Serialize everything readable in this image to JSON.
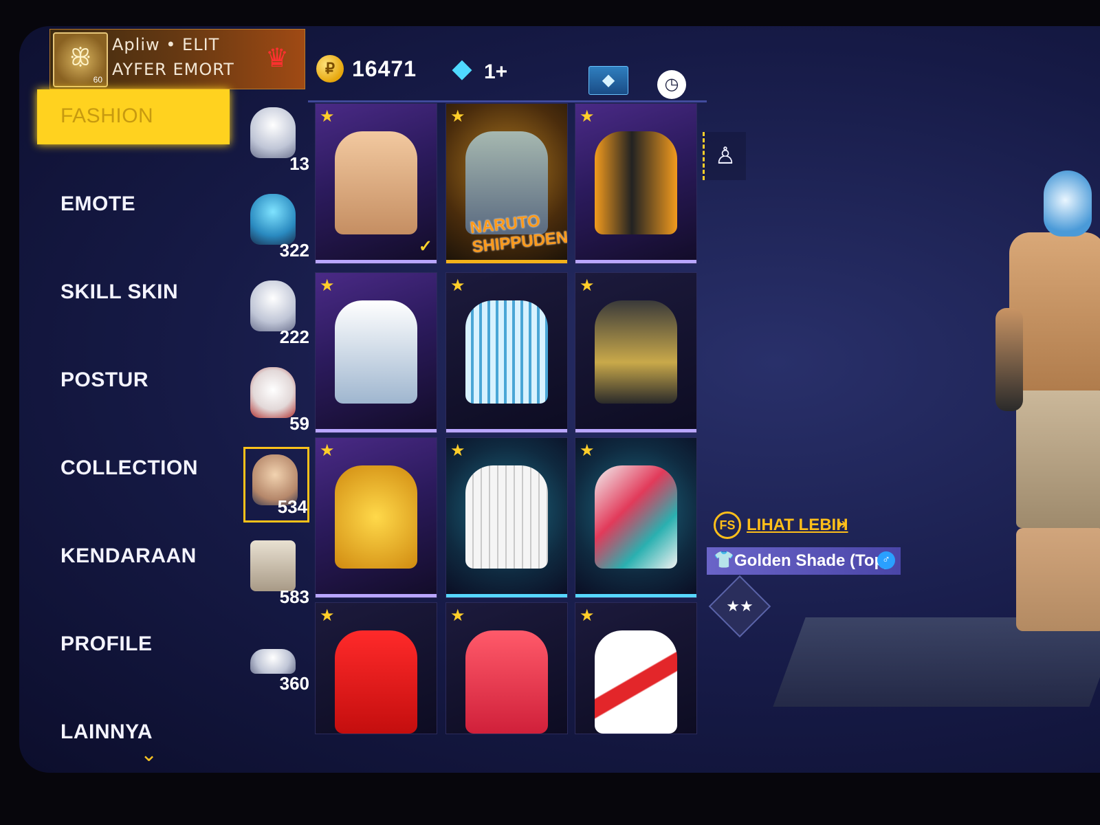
{
  "player": {
    "name": "Apliw • ELIT",
    "guild": "AYFER EMORT",
    "level": "60",
    "avatar_glyph": "ꕥ",
    "rank_icon": "shield-wings-icon"
  },
  "currency": {
    "gold": "16471",
    "diamonds": "1+",
    "gold_symbol": "₽",
    "diamond_symbol": "◆",
    "topup_symbol": "◆",
    "settings_symbol": "◷"
  },
  "categories": [
    {
      "label": "FASHION"
    },
    {
      "label": "EMOTE"
    },
    {
      "label": "SKILL SKIN"
    },
    {
      "label": "POSTUR"
    },
    {
      "label": "COLLECTION"
    },
    {
      "label": "KENDARAAN"
    },
    {
      "label": "PROFILE"
    },
    {
      "label": "LAINNYA"
    }
  ],
  "subcategories": [
    {
      "name": "outfit",
      "count": "13"
    },
    {
      "name": "headwear",
      "count": "322"
    },
    {
      "name": "mask",
      "count": "222"
    },
    {
      "name": "face-paint",
      "count": "59"
    },
    {
      "name": "tops",
      "count": "534"
    },
    {
      "name": "bottoms",
      "count": "583"
    },
    {
      "name": "shoes",
      "count": "360"
    }
  ],
  "items": [
    {
      "name": "Golden Shade (Top)",
      "equipped": true
    },
    {
      "name": "Naruto vest",
      "logo": "NARUTO SHIPPUDEN"
    },
    {
      "name": "orange hoodie"
    },
    {
      "name": "white armored top"
    },
    {
      "name": "striped jacket"
    },
    {
      "name": "hooded black top"
    },
    {
      "name": "gold jersey"
    },
    {
      "name": "white striped shirt"
    },
    {
      "name": "floral shirt"
    },
    {
      "name": "red jersey"
    },
    {
      "name": "pink jersey"
    },
    {
      "name": "white red jersey"
    }
  ],
  "preview": {
    "view_more": "LIHAT LEBIH",
    "view_more_arrows": "»",
    "equipped_name": "Golden Shade (Top)",
    "shirt_symbol": "👕",
    "gender_symbol": "♂",
    "badge_symbol": "FS",
    "rating_symbol": "★★"
  },
  "colors": {
    "accent": "#ffd21f",
    "diamond": "#4fd9ff",
    "background": "#161a46"
  }
}
